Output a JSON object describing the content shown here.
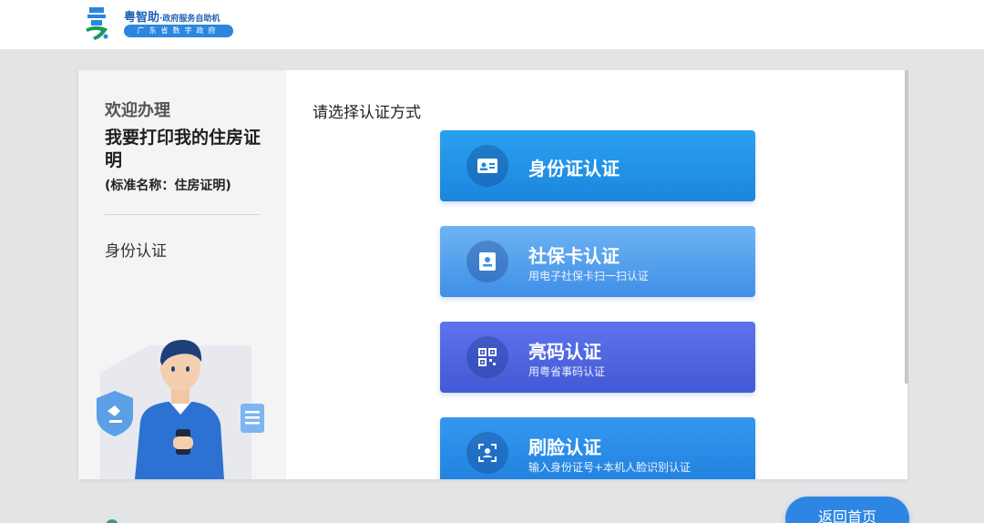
{
  "header": {
    "brand_name": "粤智助",
    "brand_sub": "·政府服务自助机",
    "brand_tagline": "广东省数字政府",
    "logo_icon": "yue-character-logo-icon"
  },
  "sidebar": {
    "welcome": "欢迎办理",
    "service_title": "我要打印我的住房证明",
    "standard_name": "(标准名称：住房证明)",
    "current_step": "身份认证"
  },
  "main": {
    "prompt": "请选择认证方式",
    "options": [
      {
        "label": "身份证认证",
        "sub": "",
        "icon": "id-card-icon"
      },
      {
        "label": "社保卡认证",
        "sub": "用电子社保卡扫一扫认证",
        "icon": "social-security-card-icon"
      },
      {
        "label": "亮码认证",
        "sub": "用粤省事码认证",
        "icon": "qr-code-icon"
      },
      {
        "label": "刷脸认证",
        "sub": "输入身份证号+本机人脸识别认证",
        "icon": "face-scan-icon"
      }
    ]
  },
  "footer": {
    "home_button": "返回首页"
  },
  "colors": {
    "primary": "#2e86e4",
    "id_button": "#1c86dd",
    "social_button": "#3f8fe8",
    "qr_button": "#4359d4",
    "face_button": "#2080de"
  }
}
